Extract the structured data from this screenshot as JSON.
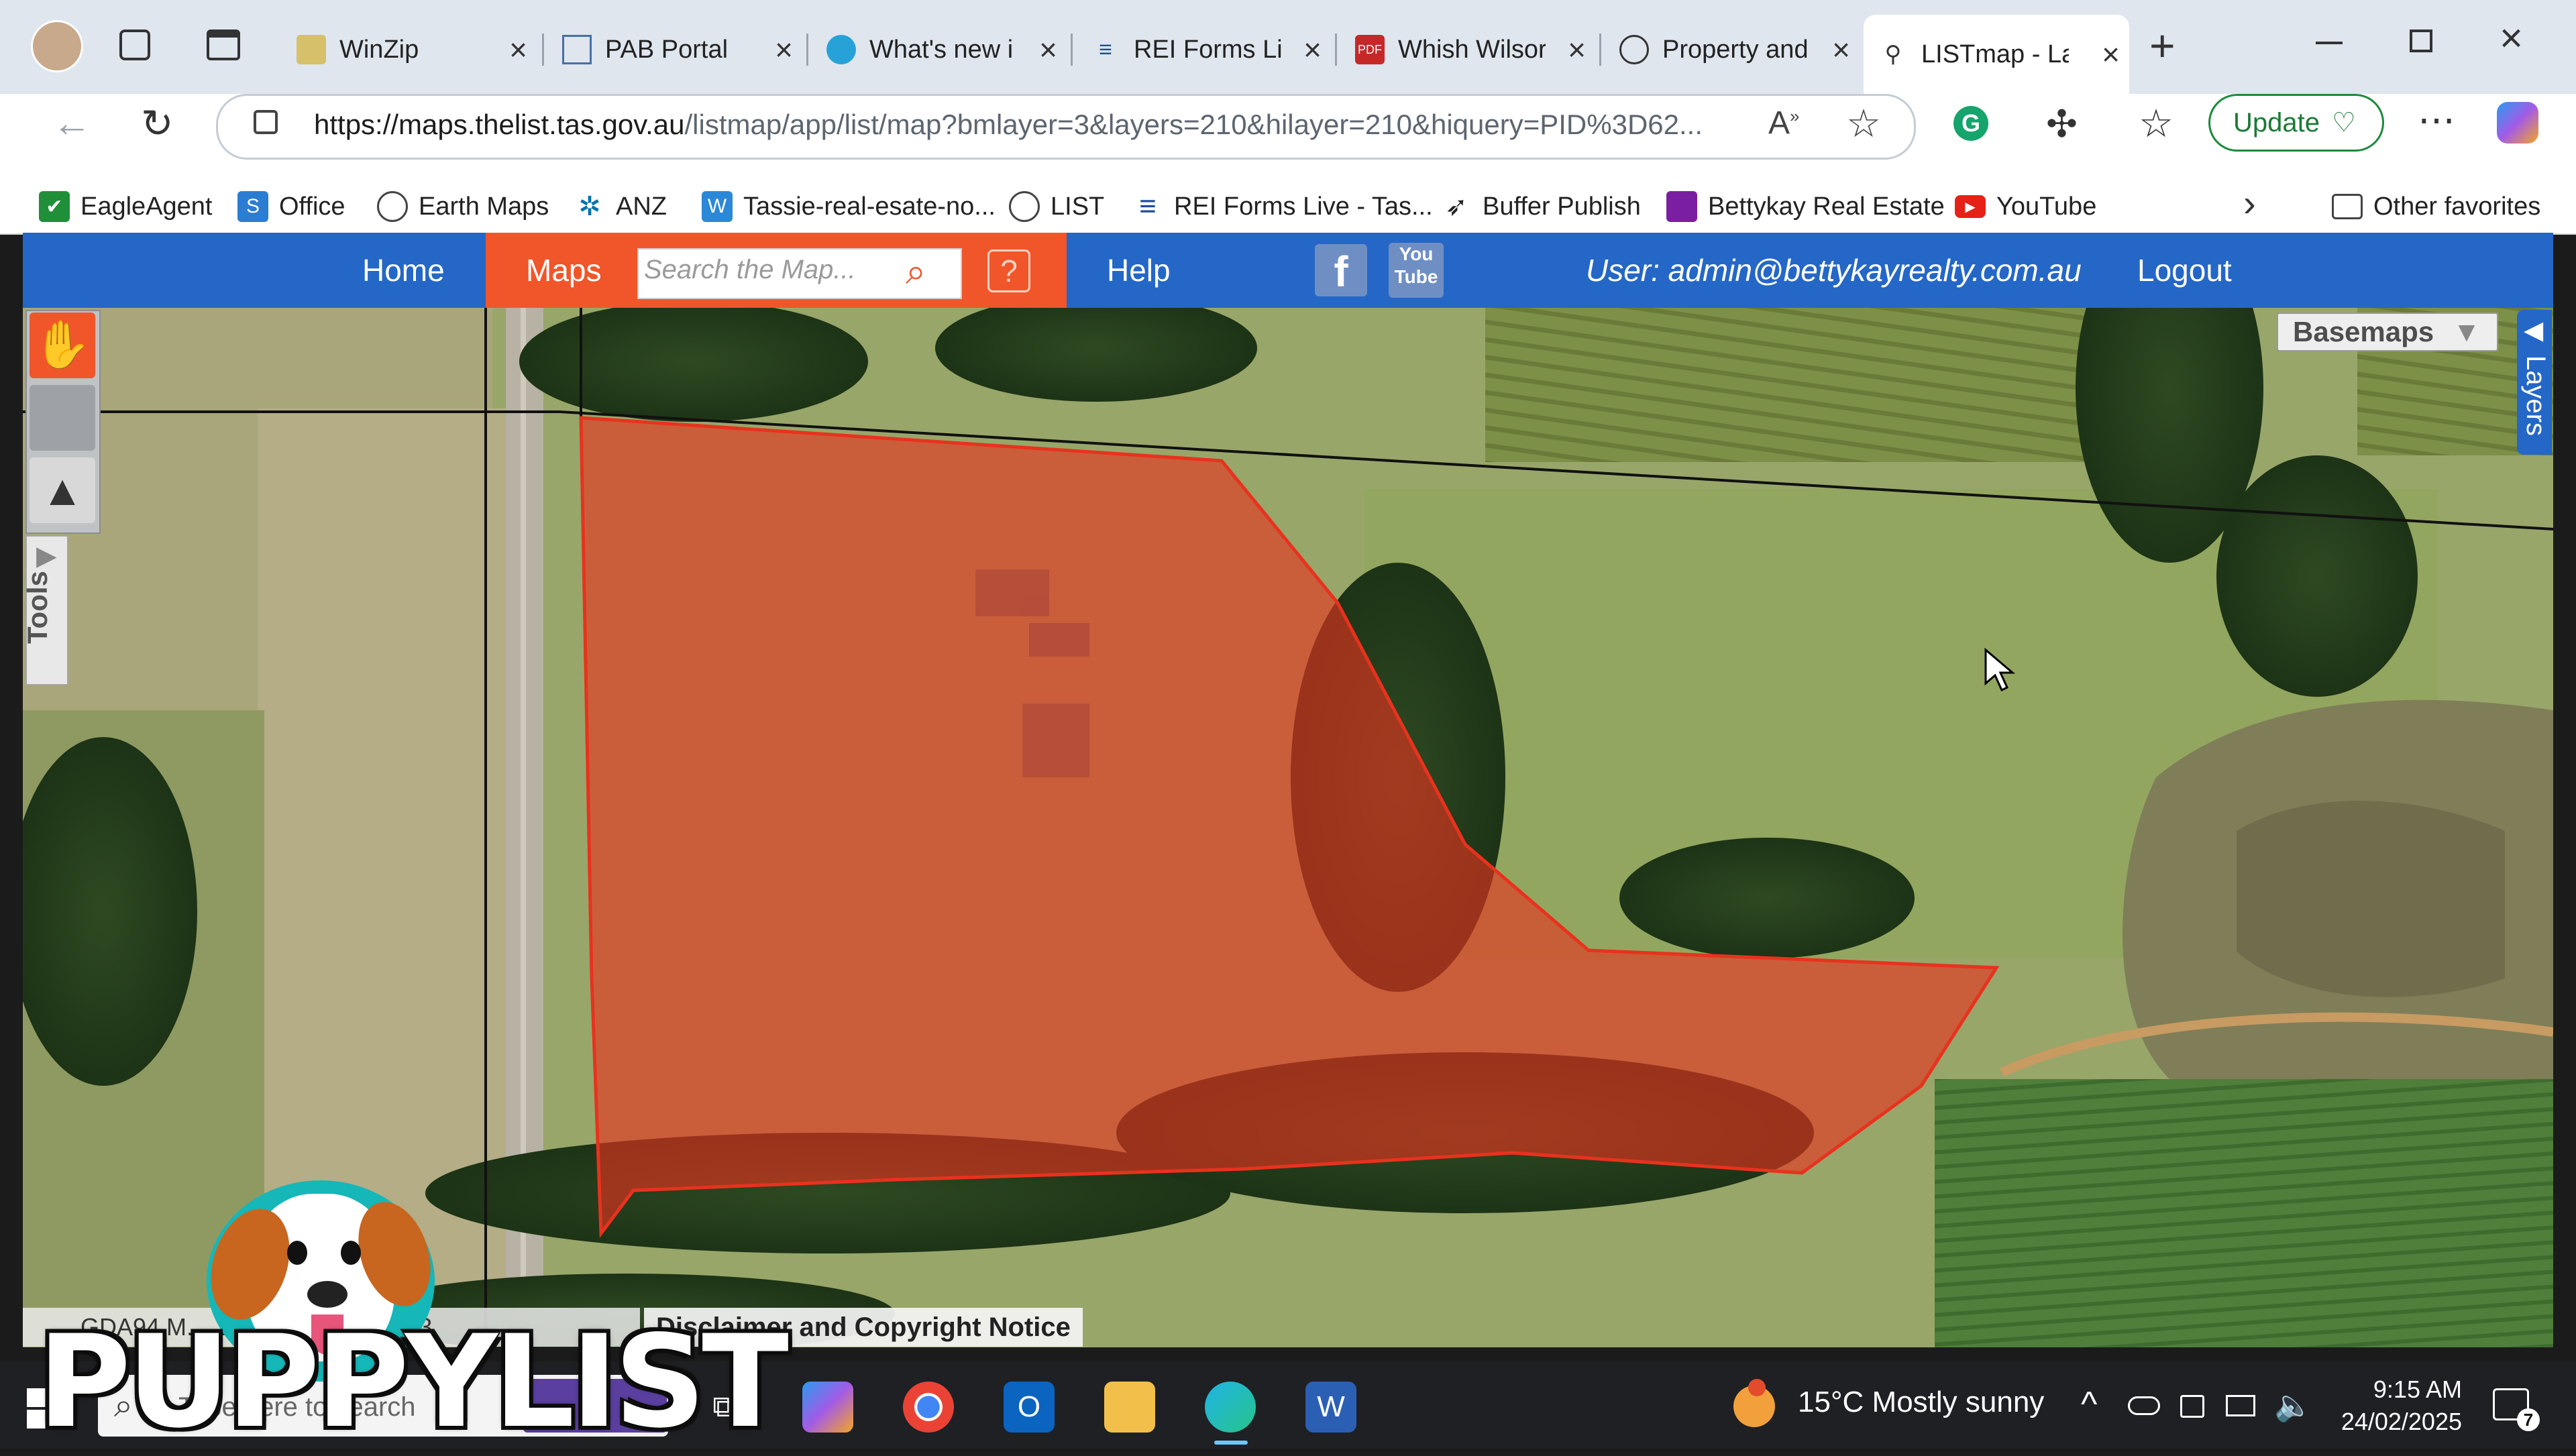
{
  "browser": {
    "tabs": [
      {
        "label": "WinZip",
        "active": false
      },
      {
        "label": "PAB Portal",
        "active": false
      },
      {
        "label": "What's new i",
        "active": false
      },
      {
        "label": "REI Forms Liv",
        "active": false
      },
      {
        "label": "Whish Wilsor",
        "active": false
      },
      {
        "label": "Property and",
        "active": false
      },
      {
        "label": "LISTmap - La",
        "active": true
      }
    ],
    "url_host": "https://maps.thelist.tas.gov.au",
    "url_path": "/listmap/app/list/map?bmlayer=3&layers=210&hilayer=210&hiquery=PID%3D62...",
    "update_label": "Update",
    "favorites": [
      {
        "label": "EagleAgent",
        "color": "#1f8f3a"
      },
      {
        "label": "Office",
        "color": "#2b7cd3"
      },
      {
        "label": "Earth Maps",
        "color": "#555555"
      },
      {
        "label": "ANZ",
        "color": "#0072ac"
      },
      {
        "label": "Tassie-real-esate-no...",
        "color": "#2b88d8"
      },
      {
        "label": "LIST",
        "color": "#555555"
      },
      {
        "label": "REI Forms Live - Tas...",
        "color": "#1f4f9c"
      },
      {
        "label": "Buffer Publish",
        "color": "#222222"
      },
      {
        "label": "Bettykay Real Estate",
        "color": "#7b1fa2"
      },
      {
        "label": "YouTube",
        "color": "#e62117"
      }
    ],
    "other_favorites": "Other favorites"
  },
  "site": {
    "nav_home": "Home",
    "nav_maps": "Maps",
    "search_placeholder": "Search the Map...",
    "nav_help": "Help",
    "user_label": "User: admin@bettykayrealty.com.au",
    "logout": "Logout",
    "facebook_icon": "f",
    "youtube_icon_top": "You",
    "youtube_icon_bottom": "Tube"
  },
  "map": {
    "basemaps_label": "Basemaps",
    "layers_label": "Layers",
    "tools_label": "Tools",
    "coords_text": "GDA94 M... ...4742390N 1:4,993",
    "disclaimer": "Disclaimer and Copyright Notice",
    "parcel_color": "#e8321e",
    "boundary_color": "#111111"
  },
  "taskbar": {
    "search_placeholder": "Type here to search",
    "weather": "15°C  Mostly sunny",
    "time": "9:15 AM",
    "date": "24/02/2025",
    "notification_count": "7"
  },
  "overlay": {
    "brand": "PUPPYLIST"
  }
}
